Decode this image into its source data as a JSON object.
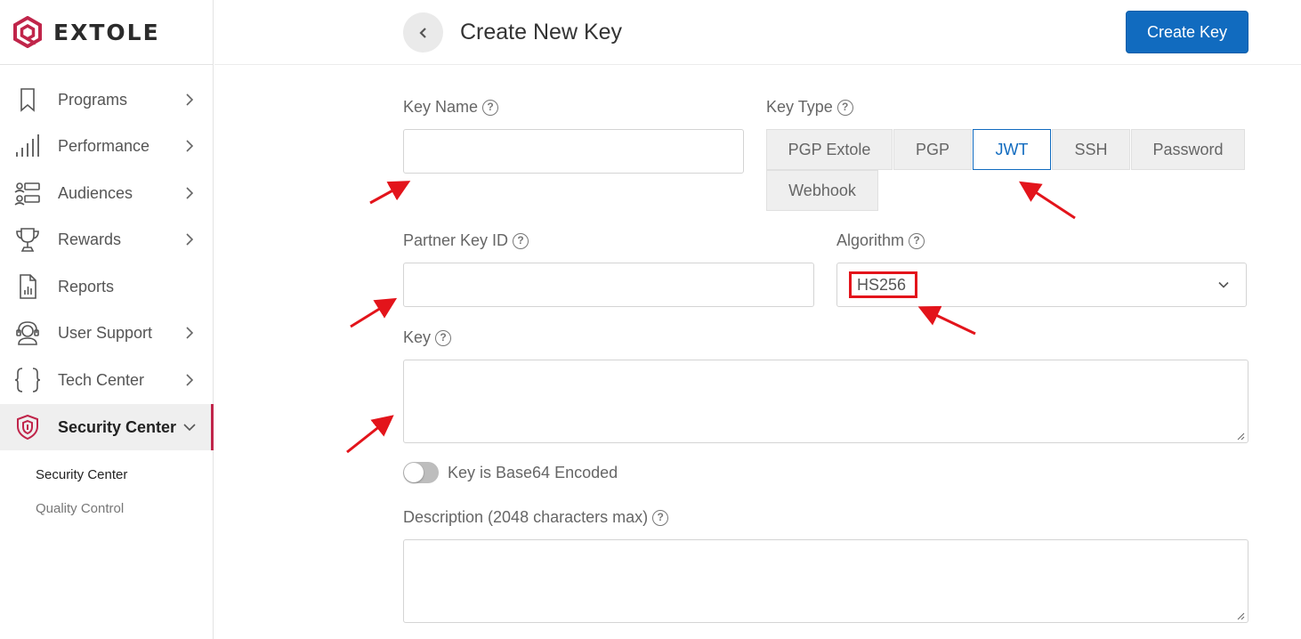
{
  "brand": {
    "name": "EXTOLE",
    "accent": "#c0254a"
  },
  "sidebar": {
    "items": [
      {
        "label": "Programs",
        "icon": "bookmark-icon"
      },
      {
        "label": "Performance",
        "icon": "bar-chart-icon"
      },
      {
        "label": "Audiences",
        "icon": "audiences-icon"
      },
      {
        "label": "Rewards",
        "icon": "trophy-icon"
      },
      {
        "label": "Reports",
        "icon": "report-icon"
      },
      {
        "label": "User Support",
        "icon": "headset-icon"
      },
      {
        "label": "Tech Center",
        "icon": "braces-icon"
      },
      {
        "label": "Security Center",
        "icon": "shield-icon",
        "active": true
      }
    ],
    "subitems": [
      {
        "label": "Security Center",
        "active": true
      },
      {
        "label": "Quality Control",
        "active": false
      }
    ]
  },
  "header": {
    "title": "Create New Key",
    "create_button": "Create Key",
    "accent": "#116bbf"
  },
  "form": {
    "key_name": {
      "label": "Key Name",
      "value": "",
      "placeholder": ""
    },
    "key_type": {
      "label": "Key Type",
      "options": [
        "PGP Extole",
        "PGP",
        "JWT",
        "SSH",
        "Password",
        "Webhook"
      ],
      "selected": "JWT"
    },
    "partner_key_id": {
      "label": "Partner Key ID",
      "value": ""
    },
    "algorithm": {
      "label": "Algorithm",
      "value": "HS256"
    },
    "key": {
      "label": "Key",
      "value": ""
    },
    "base64_toggle": {
      "label": "Key is Base64 Encoded",
      "on": false
    },
    "description": {
      "label": "Description (2048 characters max)",
      "value": ""
    }
  },
  "help_glyph": "?"
}
